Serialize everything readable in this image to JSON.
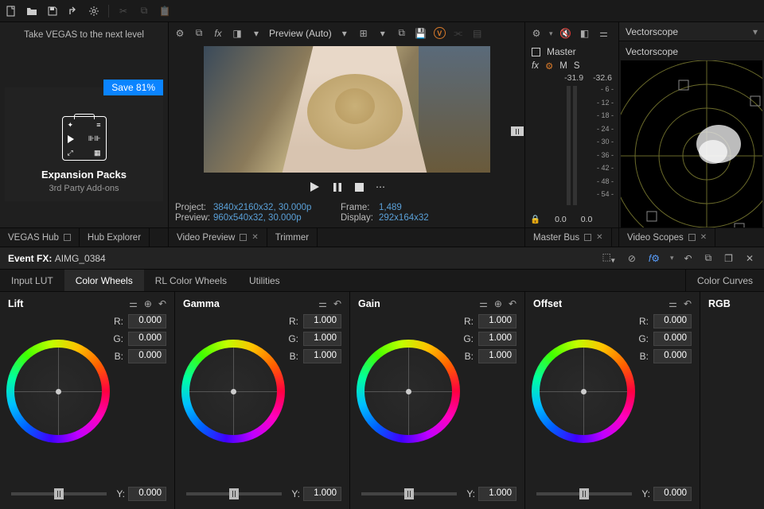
{
  "toolbar": {
    "icons": [
      "file-new",
      "folder-open",
      "save",
      "share",
      "gear",
      "cut",
      "copy",
      "paste"
    ]
  },
  "left": {
    "promo_text": "Take VEGAS to the next level",
    "save_badge": "Save 81%",
    "pack_title": "Expansion Packs",
    "pack_sub": "3rd Party Add-ons",
    "tabs": [
      "VEGAS Hub",
      "Hub Explorer"
    ]
  },
  "preview": {
    "dropdown": "Preview (Auto)",
    "info": {
      "project_lbl": "Project:",
      "project_val": "3840x2160x32, 30.000p",
      "preview_lbl": "Preview:",
      "preview_val": "960x540x32, 30.000p",
      "frame_lbl": "Frame:",
      "frame_val": "1,489",
      "display_lbl": "Display:",
      "display_val": "292x164x32"
    },
    "tabs": [
      "Video Preview",
      "Trimmer"
    ]
  },
  "meter": {
    "master": "Master",
    "m": "M",
    "s": "S",
    "peaks": [
      "-31.9",
      "-32.6"
    ],
    "scale": [
      "6",
      "12",
      "18",
      "24",
      "30",
      "36",
      "42",
      "48",
      "54"
    ],
    "foot": [
      "0.0",
      "0.0"
    ],
    "tab": "Master Bus"
  },
  "scope": {
    "dd": "Vectorscope",
    "title": "Vectorscope",
    "tab": "Video Scopes"
  },
  "fx": {
    "header_lbl": "Event FX:",
    "header_name": "AIMG_0384",
    "tabs": [
      "Input LUT",
      "Color Wheels",
      "RL Color Wheels",
      "Utilities"
    ],
    "active_tab": 1,
    "wheels": [
      {
        "name": "Lift",
        "r": "0.000",
        "g": "0.000",
        "b": "0.000",
        "y": "0.000",
        "target": true
      },
      {
        "name": "Gamma",
        "r": "1.000",
        "g": "1.000",
        "b": "1.000",
        "y": "1.000",
        "target": false
      },
      {
        "name": "Gain",
        "r": "1.000",
        "g": "1.000",
        "b": "1.000",
        "y": "1.000",
        "target": true
      },
      {
        "name": "Offset",
        "r": "0.000",
        "g": "0.000",
        "b": "0.000",
        "y": "0.000",
        "target": false
      }
    ],
    "curves_tab": "Color Curves",
    "curves_mode": "RGB"
  }
}
